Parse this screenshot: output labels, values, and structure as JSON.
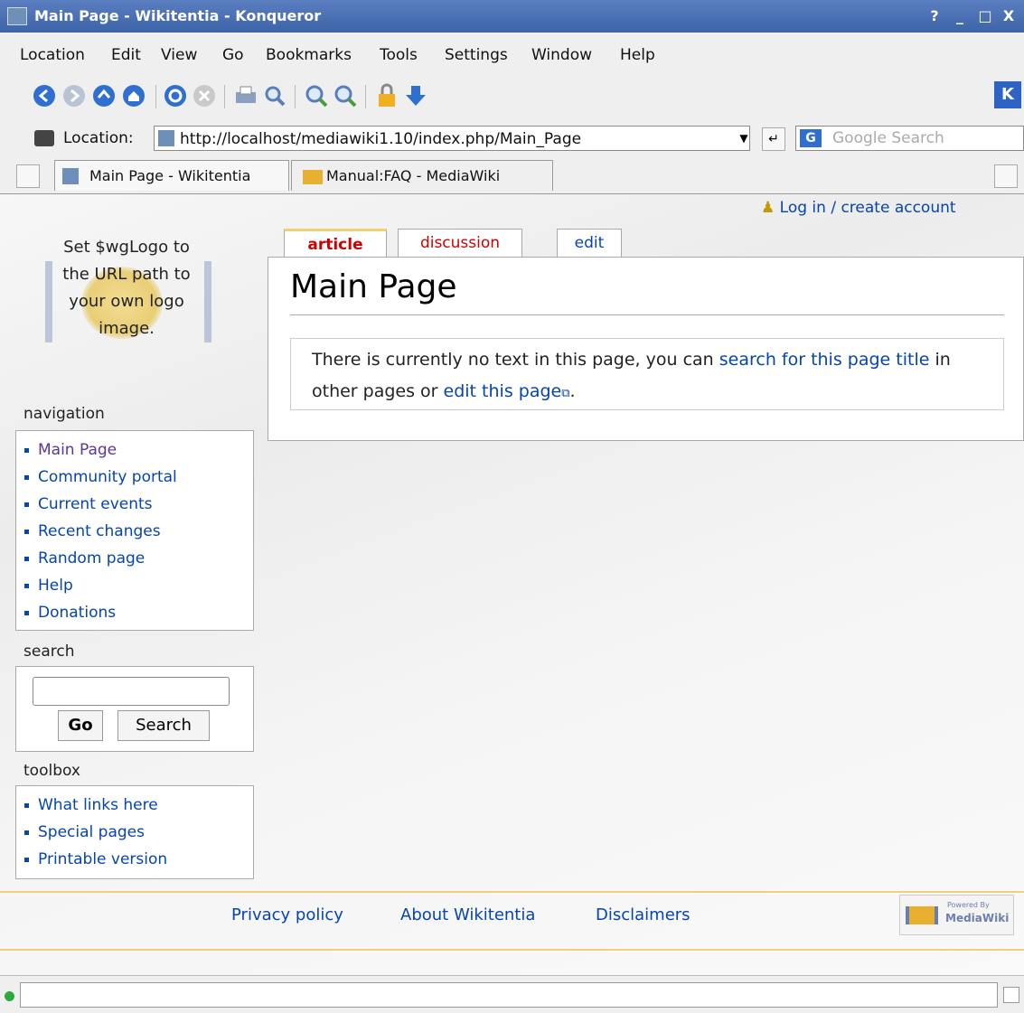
{
  "window": {
    "title": "Main Page - Wikitentia - Konqueror",
    "help_btn": "?",
    "min_btn": "_",
    "max_btn": "□",
    "close_btn": "X"
  },
  "menu": [
    "Location",
    "Edit",
    "View",
    "Go",
    "Bookmarks",
    "Tools",
    "Settings",
    "Window",
    "Help"
  ],
  "toolbar_icons": [
    "back-icon",
    "forward-icon",
    "up-icon",
    "home-icon",
    "reload-icon",
    "stop-icon",
    "print-icon",
    "find-icon",
    "zoom-in-icon",
    "zoom-out-icon",
    "security-lock-icon",
    "download-icon",
    "kde-logo-icon"
  ],
  "location": {
    "label": "Location:",
    "url": "http://localhost/mediawiki1.10/index.php/Main_Page",
    "search_placeholder": "Google Search"
  },
  "tabs": [
    {
      "label": "Main Page - Wikitentia",
      "active": true
    },
    {
      "label": "Manual:FAQ - MediaWiki",
      "active": false
    }
  ],
  "wiki": {
    "logo_text": "Set $wgLogo to the URL path to your own logo image.",
    "user_link": "Log in / create account",
    "content_tabs": [
      "article",
      "discussion",
      "edit"
    ],
    "page_title": "Main Page",
    "notice": {
      "part1": "There is currently no text in this page, you can ",
      "link1": "search for this page title",
      "part2": " in other pages or ",
      "link2": "edit this page",
      "part3": "."
    },
    "navigation": {
      "heading": "navigation",
      "items": [
        "Main Page",
        "Community portal",
        "Current events",
        "Recent changes",
        "Random page",
        "Help",
        "Donations"
      ]
    },
    "search": {
      "heading": "search",
      "go": "Go",
      "search": "Search"
    },
    "toolbox": {
      "heading": "toolbox",
      "items": [
        "What links here",
        "Special pages",
        "Printable version"
      ]
    },
    "footer": {
      "links": [
        "Privacy policy",
        "About Wikitentia",
        "Disclaimers"
      ],
      "powered_small": "Powered By",
      "powered_big": "MediaWiki"
    }
  },
  "colors": {
    "title_bar": "#4a6fb3",
    "link": "#0645ad",
    "active_tab": "#cc0000",
    "footer_line": "#f2d072"
  }
}
